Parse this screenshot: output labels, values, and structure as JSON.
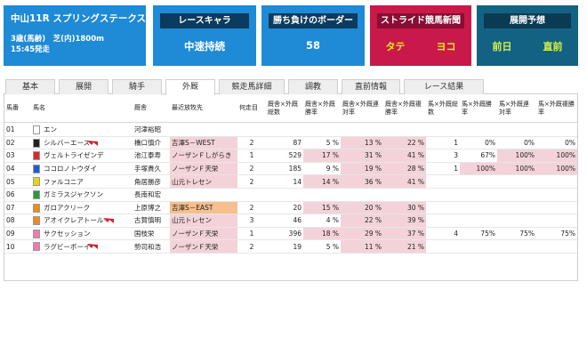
{
  "race": {
    "title": "中山11R スプリングステークス",
    "line1": "3歳(馬齢)　芝(内)1800m",
    "line2": "15:45発走"
  },
  "cards": {
    "pace": {
      "label": "レースキャラ",
      "value": "中速持続"
    },
    "border": {
      "label": "勝ち負けのボーダー",
      "value": "58"
    },
    "stride": {
      "label": "ストライド競馬新聞",
      "left": "タテ",
      "right": "ヨコ"
    },
    "forecast": {
      "label": "展開予想",
      "left": "前日",
      "right": "直前"
    }
  },
  "colors": {
    "blue": "#1f8ad6",
    "red": "#c8194a",
    "teal": "#136283",
    "pink": "#f3d3d9",
    "orange": "#f5bf8e"
  },
  "tabs": [
    "基本",
    "展開",
    "騎手",
    "外厩",
    "競走馬詳細",
    "調教",
    "直前情報",
    "レース結果"
  ],
  "active_tab": "外厩",
  "headers": [
    "馬番",
    "馬名",
    "厩舎",
    "最近放牧先",
    "何走目",
    "厩舎×外厩総数",
    "厩舎×外厩勝率",
    "厩舎×外厩連対率",
    "厩舎×外厩複勝率",
    "馬×外厩総数",
    "馬×外厩勝率",
    "馬×外厩連対率",
    "馬×外厩複勝率"
  ],
  "rows": [
    {
      "no": "01",
      "name": "エン",
      "stable": "河津裕昭",
      "farm": "",
      "run": "",
      "c1": "",
      "c2": "",
      "c3": "",
      "c4": "",
      "h1": "",
      "h2": "",
      "h3": "",
      "h4": "",
      "frame": "#ffffff",
      "trend": false
    },
    {
      "no": "02",
      "name": "シルバーエース",
      "stable": "橋口慎介",
      "farm": "吉澤S－WEST",
      "run": "2",
      "c1": "87",
      "c2": "5 %",
      "c3": "13 %",
      "c4": "22 %",
      "h1": "1",
      "h2": "0%",
      "h3": "0%",
      "h4": "0%",
      "frame": "#222222",
      "trend": true
    },
    {
      "no": "03",
      "name": "ヴェルトライゼンデ",
      "stable": "池江泰寿",
      "farm": "ノーザンＦしがらき",
      "run": "1",
      "c1": "529",
      "c2": "17 %",
      "c3": "31 %",
      "c4": "41 %",
      "h1": "3",
      "h2": "67%",
      "h3": "100%",
      "h4": "100%",
      "frame": "#d62a2a",
      "trend": false
    },
    {
      "no": "04",
      "name": "ココロノトウダイ",
      "stable": "手塚貴久",
      "farm": "ノーザンＦ天栄",
      "run": "2",
      "c1": "185",
      "c2": "9 %",
      "c3": "19 %",
      "c4": "28 %",
      "h1": "1",
      "h2": "100%",
      "h3": "100%",
      "h4": "100%",
      "frame": "#1e5bd6",
      "trend": false
    },
    {
      "no": "05",
      "name": "ファルコニア",
      "stable": "角居勝彦",
      "farm": "山元トレセン",
      "run": "2",
      "c1": "14",
      "c2": "14 %",
      "c3": "36 %",
      "c4": "41 %",
      "h1": "",
      "h2": "",
      "h3": "",
      "h4": "",
      "frame": "#e5d21f",
      "trend": false
    },
    {
      "no": "06",
      "name": "ガミラスジャクソン",
      "stable": "長南和宏",
      "farm": "",
      "run": "",
      "c1": "",
      "c2": "",
      "c3": "",
      "c4": "",
      "h1": "",
      "h2": "",
      "h3": "",
      "h4": "",
      "frame": "#2a9a3a",
      "trend": false
    },
    {
      "no": "07",
      "name": "ガロアクリーク",
      "stable": "上原博之",
      "farm": "吉澤S－EAST",
      "run": "2",
      "c1": "20",
      "c2": "15 %",
      "c3": "20 %",
      "c4": "30 %",
      "h1": "",
      "h2": "",
      "h3": "",
      "h4": "",
      "frame": "#f08a1a",
      "trend": false
    },
    {
      "no": "08",
      "name": "アオイクレアトール",
      "stable": "古賀慎明",
      "farm": "山元トレセン",
      "run": "3",
      "c1": "46",
      "c2": "4 %",
      "c3": "22 %",
      "c4": "39 %",
      "h1": "",
      "h2": "",
      "h3": "",
      "h4": "",
      "frame": "#f08a1a",
      "trend": true
    },
    {
      "no": "09",
      "name": "サクセッション",
      "stable": "国枝栄",
      "farm": "ノーザンＦ天栄",
      "run": "1",
      "c1": "396",
      "c2": "18 %",
      "c3": "29 %",
      "c4": "37 %",
      "h1": "4",
      "h2": "75%",
      "h3": "75%",
      "h4": "75%",
      "frame": "#f07ab0",
      "trend": false
    },
    {
      "no": "10",
      "name": "ラグビーボーイ",
      "stable": "勢司和浩",
      "farm": "ノーザンＦ天栄",
      "run": "2",
      "c1": "19",
      "c2": "5 %",
      "c3": "11 %",
      "c4": "21 %",
      "h1": "",
      "h2": "",
      "h3": "",
      "h4": "",
      "frame": "#f07ab0",
      "trend": true
    }
  ]
}
